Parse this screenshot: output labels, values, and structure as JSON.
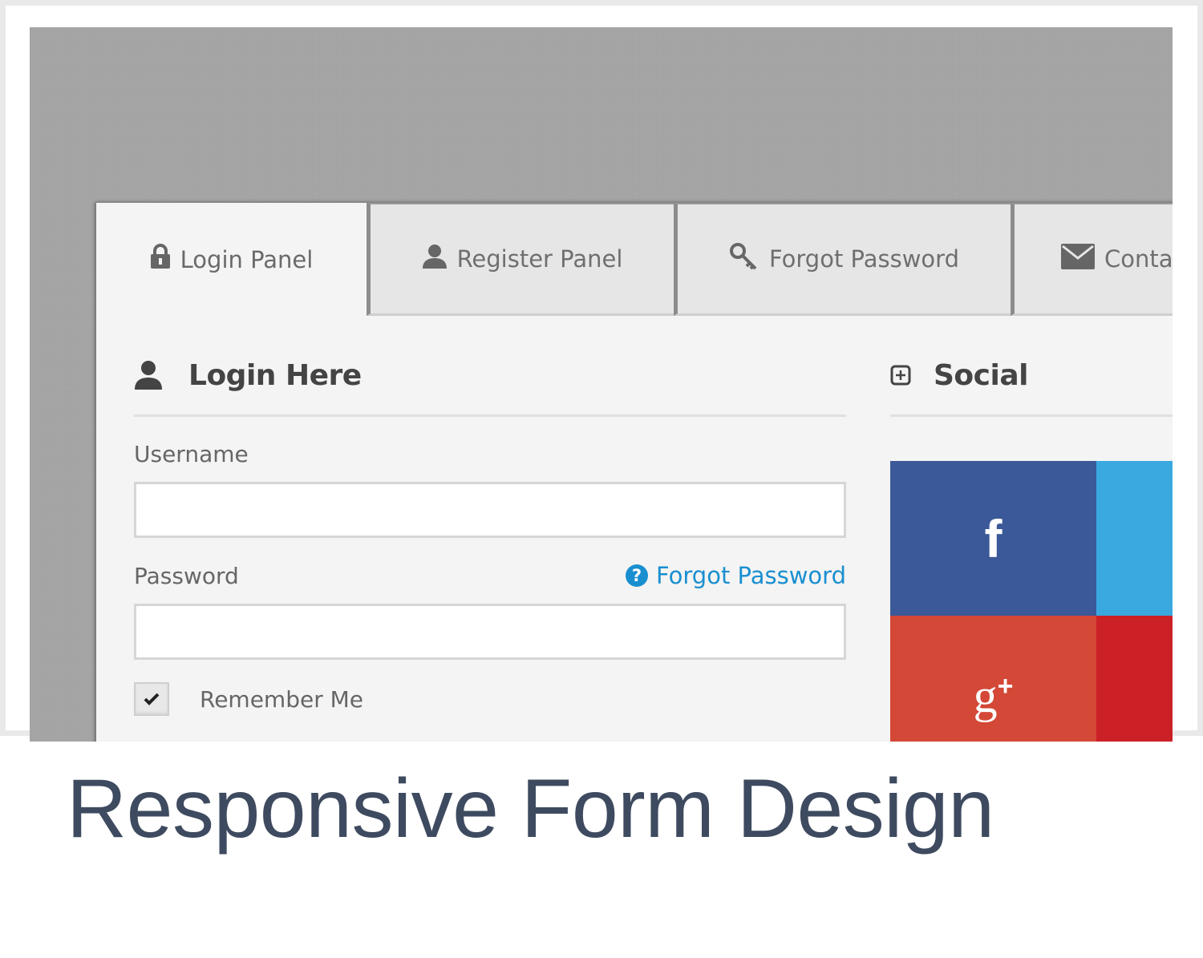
{
  "tabs": [
    {
      "label": "Login Panel",
      "icon": "lock-icon",
      "active": true
    },
    {
      "label": "Register Panel",
      "icon": "user-icon",
      "active": false
    },
    {
      "label": "Forgot Password",
      "icon": "key-icon",
      "active": false
    },
    {
      "label": "Conta",
      "icon": "envelope-icon",
      "active": false
    }
  ],
  "login": {
    "title": "Login Here",
    "username_label": "Username",
    "username_value": "",
    "password_label": "Password",
    "password_value": "",
    "forgot_link": "Forgot Password",
    "forgot_icon": "?",
    "remember_label": "Remember Me",
    "remember_checked": true
  },
  "social": {
    "title": "Social",
    "tiles": [
      {
        "name": "facebook",
        "glyph": "f",
        "color": "#3b5998"
      },
      {
        "name": "twitter",
        "glyph": "",
        "color": "#3aa9e0"
      },
      {
        "name": "google-plus",
        "glyph": "g",
        "glyph_sup": "+",
        "color": "#d34836"
      },
      {
        "name": "pinterest",
        "glyph": "",
        "color": "#cc2027"
      }
    ]
  },
  "caption": "Responsive Form Design",
  "colors": {
    "link": "#1a8fd0",
    "caption": "#3e4a5f",
    "backdrop": "#a6a6a6",
    "panel": "#f4f4f4"
  }
}
